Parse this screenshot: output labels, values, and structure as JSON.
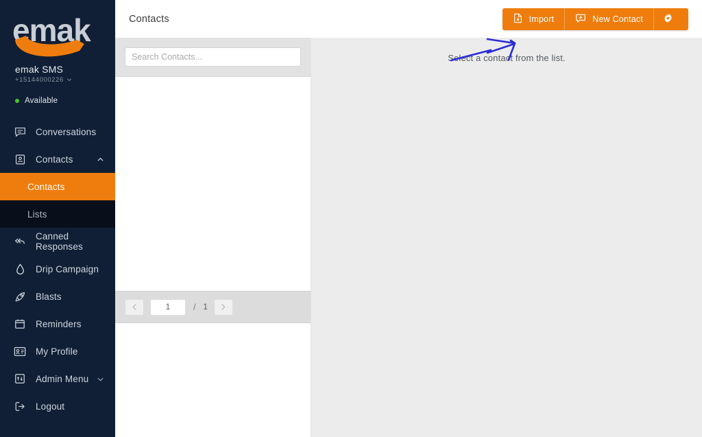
{
  "brand": {
    "logo_text": "emak",
    "logo_color": "#c9ced6",
    "accent": "#ef7d0d",
    "sidebar_bg": "#101f35"
  },
  "account": {
    "name": "emak SMS",
    "phone": "+15144000226",
    "phone_caret_icon": "chevron-down-icon",
    "status": "Available",
    "status_color": "#49c928"
  },
  "sidebar": {
    "items": [
      {
        "label": "Conversations",
        "icon": "chat-bubble-icon",
        "caret": ""
      },
      {
        "label": "Contacts",
        "icon": "contact-card-icon",
        "caret": "chevron-up-icon"
      },
      {
        "label": "Canned Responses",
        "icon": "reply-all-icon",
        "caret": ""
      },
      {
        "label": "Drip Campaign",
        "icon": "droplet-icon",
        "caret": ""
      },
      {
        "label": "Blasts",
        "icon": "rocket-icon",
        "caret": ""
      },
      {
        "label": "Reminders",
        "icon": "calendar-icon",
        "caret": ""
      },
      {
        "label": "My Profile",
        "icon": "id-badge-icon",
        "caret": ""
      },
      {
        "label": "Admin Menu",
        "icon": "admin-grid-icon",
        "caret": "chevron-down-icon"
      },
      {
        "label": "Logout",
        "icon": "logout-icon",
        "caret": ""
      }
    ],
    "contacts_submenu": [
      {
        "label": "Contacts",
        "state": "active"
      },
      {
        "label": "Lists",
        "state": "dim"
      }
    ]
  },
  "header": {
    "title": "Contacts",
    "buttons": [
      {
        "label": "Import",
        "icon": "file-import-icon"
      },
      {
        "label": "New Contact",
        "icon": "chat-plus-icon"
      },
      {
        "label": "",
        "icon": "gear-icon"
      }
    ]
  },
  "list_panel": {
    "search": {
      "placeholder": "Search Contacts...",
      "value": "",
      "icon": "search-input"
    },
    "pagination": {
      "prev_icon": "chevron-left-icon",
      "next_icon": "chevron-right-icon",
      "current_page": "1",
      "separator": "/",
      "total_pages": "1"
    }
  },
  "main": {
    "empty_message": "Select a contact from the list.",
    "annotation": {
      "type": "hand-drawn-arrow",
      "color": "#2b2bd8",
      "points_to": "Import"
    }
  }
}
